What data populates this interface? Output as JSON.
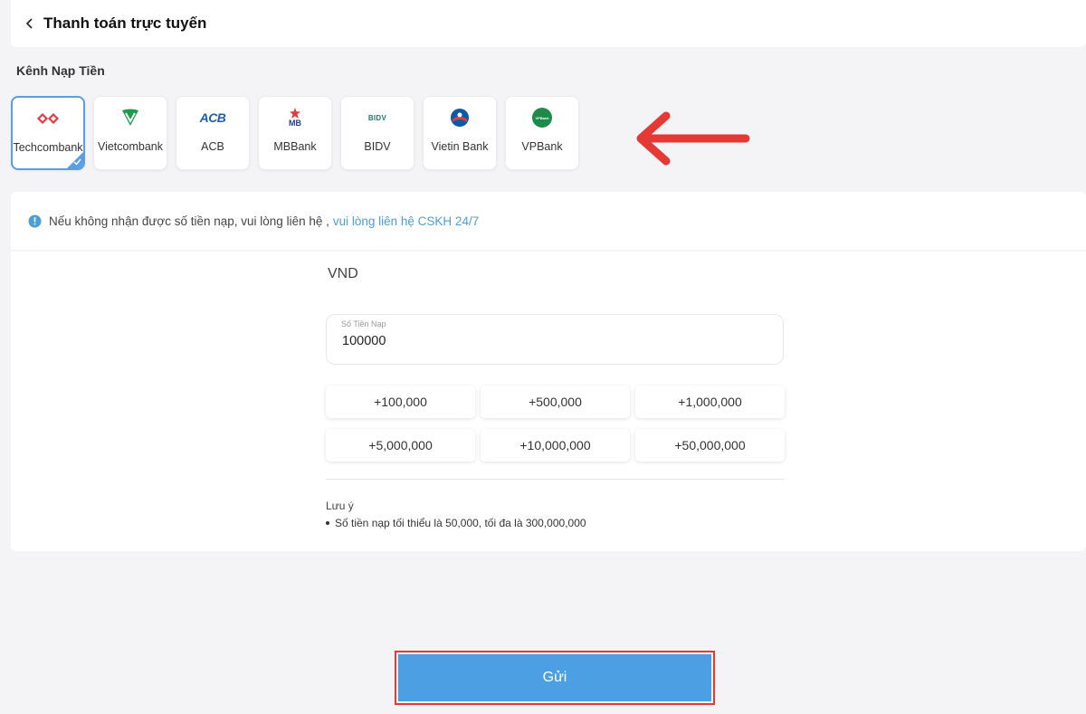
{
  "header": {
    "title": "Thanh toán trực tuyến"
  },
  "channel": {
    "section_title": "Kênh Nạp Tiền",
    "banks": [
      {
        "name": "Techcombank",
        "selected": true
      },
      {
        "name": "Vietcombank",
        "selected": false
      },
      {
        "name": "ACB",
        "selected": false
      },
      {
        "name": "MBBank",
        "selected": false
      },
      {
        "name": "BIDV",
        "selected": false
      },
      {
        "name": "Vietin Bank",
        "selected": false
      },
      {
        "name": "VPBank",
        "selected": false
      }
    ],
    "logo_text": {
      "acb": "ACB",
      "mb": "MB",
      "bidv": "BIDV",
      "vpbank": "VPBank"
    }
  },
  "notice": {
    "text": "Nếu không nhận được số tiền nạp, vui lòng liên hệ ,",
    "link": "vui lòng liên hệ CSKH 24/7"
  },
  "form": {
    "currency": "VND",
    "amount_label": "Số Tiền Nạp",
    "amount_value": "100000",
    "quick_amounts": [
      "+100,000",
      "+500,000",
      "+1,000,000",
      "+5,000,000",
      "+10,000,000",
      "+50,000,000"
    ],
    "note_title": "Lưu ý",
    "notes": [
      "Số tiền nạp tối thiểu là 50,000, tối đa là 300,000,000"
    ]
  },
  "submit": {
    "label": "Gửi"
  },
  "colors": {
    "accent": "#4d9fe3",
    "link": "#4a9fd6",
    "annotation_red": "#e53935"
  }
}
